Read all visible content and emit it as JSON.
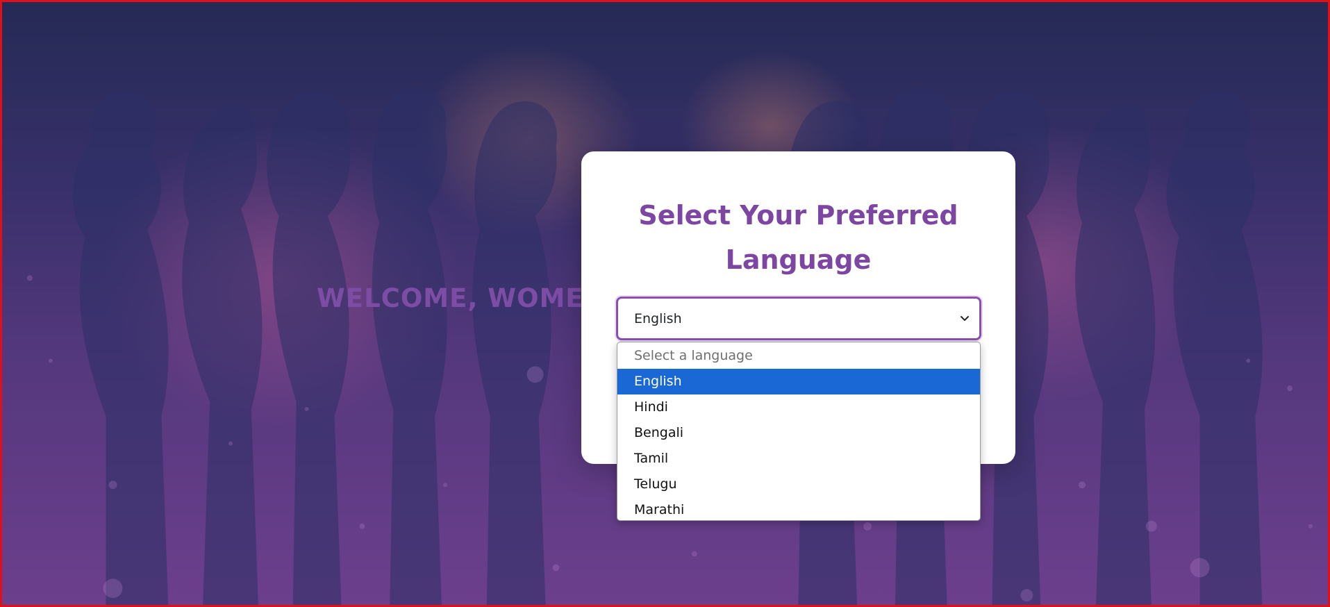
{
  "welcome_text": "WELCOME, WOMEN",
  "card": {
    "title": "Select Your Preferred Language"
  },
  "language_select": {
    "selected_value": "English",
    "options": [
      {
        "label": "Select a language",
        "placeholder": true
      },
      {
        "label": "English",
        "selected": true
      },
      {
        "label": "Hindi"
      },
      {
        "label": "Bengali"
      },
      {
        "label": "Tamil"
      },
      {
        "label": "Telugu"
      },
      {
        "label": "Marathi"
      }
    ]
  },
  "colors": {
    "accent_purple": "#7d46a2",
    "selected_option": "#1a68d6",
    "window_border": "#e0101a"
  }
}
